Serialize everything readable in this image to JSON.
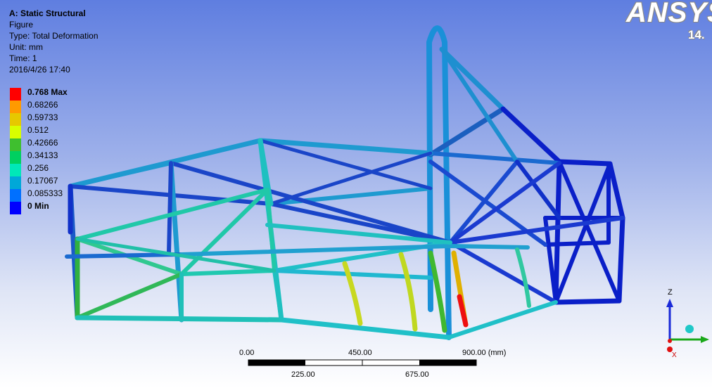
{
  "info": {
    "title": "A: Static Structural",
    "line1": "Figure",
    "line2": "Type: Total Deformation",
    "line3": "Unit: mm",
    "line4": "Time: 1",
    "line5": "2016/4/26 17:40"
  },
  "legend": [
    {
      "label": "0.768 Max",
      "color": "#ff0000",
      "bold": true
    },
    {
      "label": "0.68266",
      "color": "#ff9a00",
      "bold": false
    },
    {
      "label": "0.59733",
      "color": "#e6c800",
      "bold": false
    },
    {
      "label": "0.512",
      "color": "#d8ff00",
      "bold": false
    },
    {
      "label": "0.42666",
      "color": "#3fbf2f",
      "bold": false
    },
    {
      "label": "0.34133",
      "color": "#00d060",
      "bold": false
    },
    {
      "label": "0.256",
      "color": "#00e8b8",
      "bold": false
    },
    {
      "label": "0.17067",
      "color": "#00a8d8",
      "bold": false
    },
    {
      "label": "0.085333",
      "color": "#0070ff",
      "bold": false
    },
    {
      "label": "0 Min",
      "color": "#0000ff",
      "bold": true
    }
  ],
  "logo": {
    "text": "ANSYS",
    "version": "14."
  },
  "scale": {
    "top_labels": [
      "0.00",
      "450.00",
      "900.00 (mm)"
    ],
    "bottom_labels": [
      "225.00",
      "675.00"
    ]
  },
  "triad": {
    "z_label": "Z",
    "x_label": "X"
  }
}
